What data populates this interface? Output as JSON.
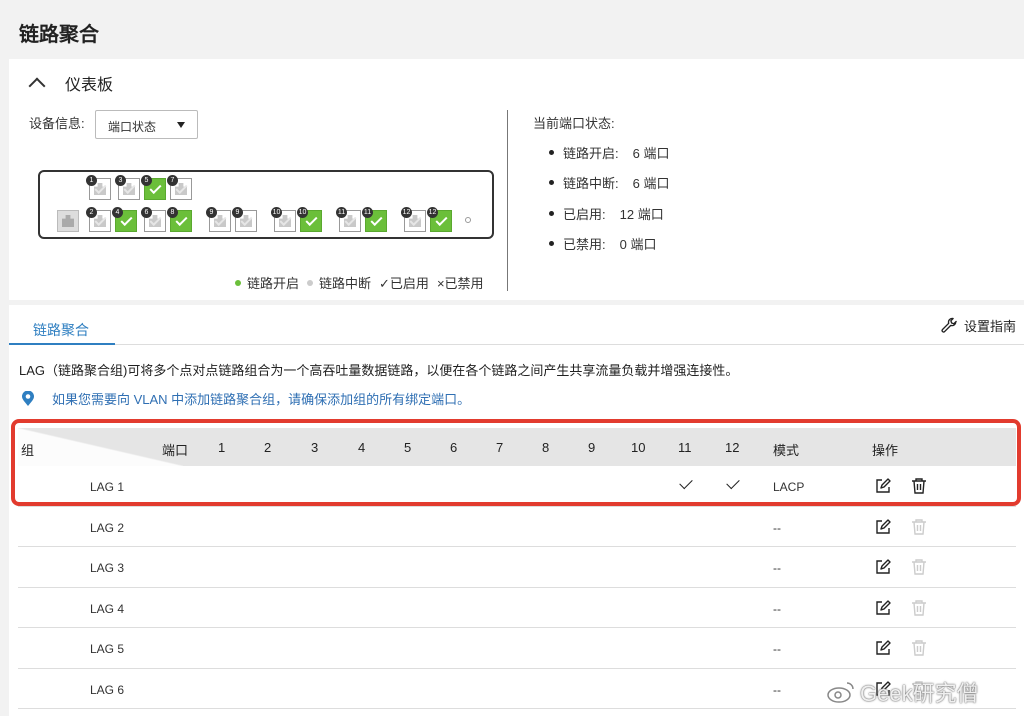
{
  "page_title": "链路聚合",
  "dashboard": {
    "title": "仪表板",
    "device_info_label": "设备信息:",
    "device_select": "端口状态",
    "legend": {
      "link_up": "链路开启",
      "link_down": "链路中断",
      "enabled": "✓已启用",
      "disabled": "×已禁用",
      "up_color": "#6bbf3a",
      "down_color": "#cccccc"
    },
    "ports_top": [
      {
        "num": "1",
        "state": "gray"
      },
      {
        "num": "3",
        "state": "gray"
      },
      {
        "num": "5",
        "state": "green"
      },
      {
        "num": "7",
        "state": "gray"
      }
    ],
    "ports_bottom": [
      {
        "num": "2",
        "state": "gray"
      },
      {
        "num": "4",
        "state": "green"
      },
      {
        "num": "6",
        "state": "gray"
      },
      {
        "num": "8",
        "state": "green"
      },
      {
        "num": "9",
        "state": "gray"
      },
      {
        "num": "9",
        "state": "gray"
      },
      {
        "num": "10",
        "state": "gray"
      },
      {
        "num": "10",
        "state": "green"
      },
      {
        "num": "11",
        "state": "gray"
      },
      {
        "num": "11",
        "state": "green"
      },
      {
        "num": "12",
        "state": "gray"
      },
      {
        "num": "12",
        "state": "green"
      }
    ],
    "status_title": "当前端口状态:",
    "status": [
      {
        "label": "链路开启:",
        "value": "6 端口"
      },
      {
        "label": "链路中断:",
        "value": "6 端口"
      },
      {
        "label": "已启用:",
        "value": "12 端口"
      },
      {
        "label": "已禁用:",
        "value": "0 端口"
      }
    ]
  },
  "lag": {
    "tab_label": "链路聚合",
    "guide_label": "设置指南",
    "description": "LAG（链路聚合组)可将多个点对点链路组合为一个高吞吐量数据链路，以便在各个链路之间产生共享流量负载并增强连接性。",
    "tip": "如果您需要向 VLAN 中添加链路聚合组，请确保添加组的所有绑定端口。",
    "columns": {
      "group": "组",
      "port": "端口",
      "ports": [
        "1",
        "2",
        "3",
        "4",
        "5",
        "6",
        "7",
        "8",
        "9",
        "10",
        "11",
        "12"
      ],
      "mode": "模式",
      "action": "操作"
    },
    "rows": [
      {
        "name": "LAG 1",
        "checked": [
          11,
          12
        ],
        "mode": "LACP",
        "delete_enabled": true
      },
      {
        "name": "LAG 2",
        "checked": [],
        "mode": "--",
        "delete_enabled": false
      },
      {
        "name": "LAG 3",
        "checked": [],
        "mode": "--",
        "delete_enabled": false
      },
      {
        "name": "LAG 4",
        "checked": [],
        "mode": "--",
        "delete_enabled": false
      },
      {
        "name": "LAG 5",
        "checked": [],
        "mode": "--",
        "delete_enabled": false
      },
      {
        "name": "LAG 6",
        "checked": [],
        "mode": "--",
        "delete_enabled": false
      }
    ]
  },
  "watermark": "Geek研究僧",
  "highlight_color": "#e23b2e"
}
